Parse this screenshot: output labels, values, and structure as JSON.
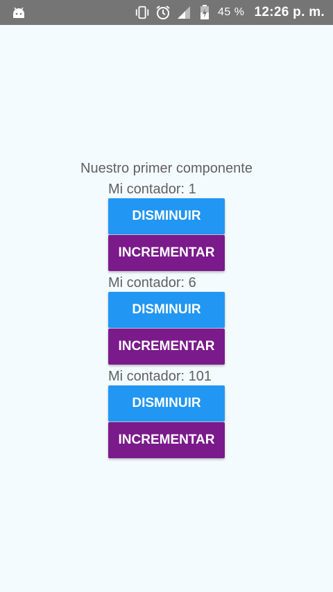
{
  "status_bar": {
    "battery_percent": "45 %",
    "time": "12:26 p. m.",
    "icons": [
      "android-icon",
      "vibrate-icon",
      "alarm-icon",
      "signal-icon",
      "battery-icon"
    ]
  },
  "page": {
    "title": "Nuestro primer componente"
  },
  "counters": [
    {
      "label": "Mi contador: 1",
      "decrement_label": "DISMINUIR",
      "increment_label": "INCREMENTAR"
    },
    {
      "label": "Mi contador: 6",
      "decrement_label": "DISMINUIR",
      "increment_label": "INCREMENTAR"
    },
    {
      "label": "Mi contador: 101",
      "decrement_label": "DISMINUIR",
      "increment_label": "INCREMENTAR"
    }
  ],
  "colors": {
    "status_bar": "#757575",
    "background": "#f4fbff",
    "decrement_button": "#2196f3",
    "increment_button": "#7b1a8b",
    "text": "#606060"
  }
}
